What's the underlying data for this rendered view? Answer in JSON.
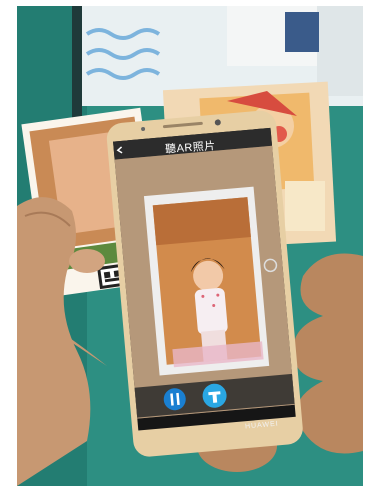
{
  "scene": {
    "app_title": "聽AR照片",
    "phone_brand": "HUAWEI",
    "icons": [
      "back-arrow-icon",
      "pause-icon",
      "share-icon",
      "refresh-icon"
    ],
    "colors": {
      "teal_wall": "#2a8c80",
      "phone_gold": "#e7cfa4",
      "pause_button": "#1a7fd1",
      "share_button": "#2aa7e3"
    }
  }
}
